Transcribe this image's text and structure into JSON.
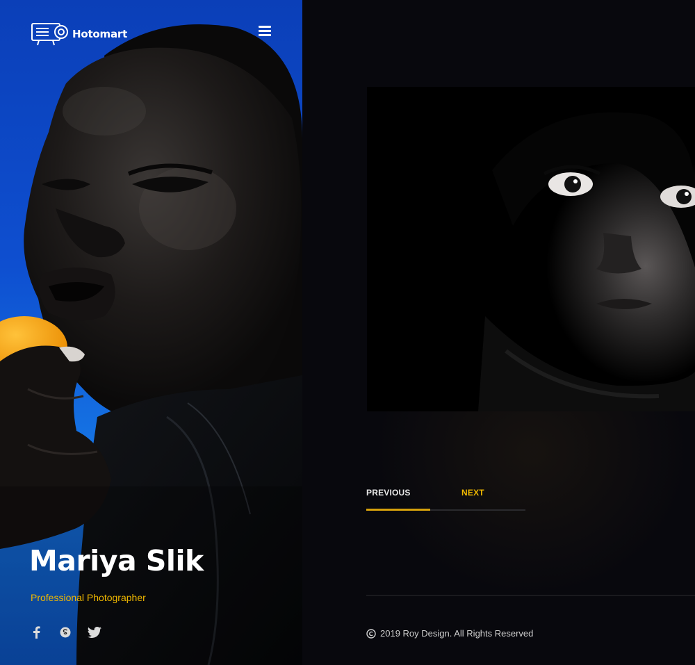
{
  "header": {
    "logo_text": "Hotomart",
    "menu_icon": "hamburger-menu-icon"
  },
  "profile": {
    "name": "Mariya Slik",
    "role": "Professional Photographer",
    "socials": [
      "facebook-icon",
      "skype-icon",
      "twitter-icon"
    ]
  },
  "gallery": {
    "previous_label": "PREVIOUS",
    "next_label": "NEXT",
    "progress": 0.4
  },
  "footer": {
    "copyright": "2019 Roy Design.  All Rights Reserved"
  },
  "colors": {
    "accent": "#f0b800",
    "left_bg": "#0e4fd0",
    "page_bg": "#08080c"
  }
}
